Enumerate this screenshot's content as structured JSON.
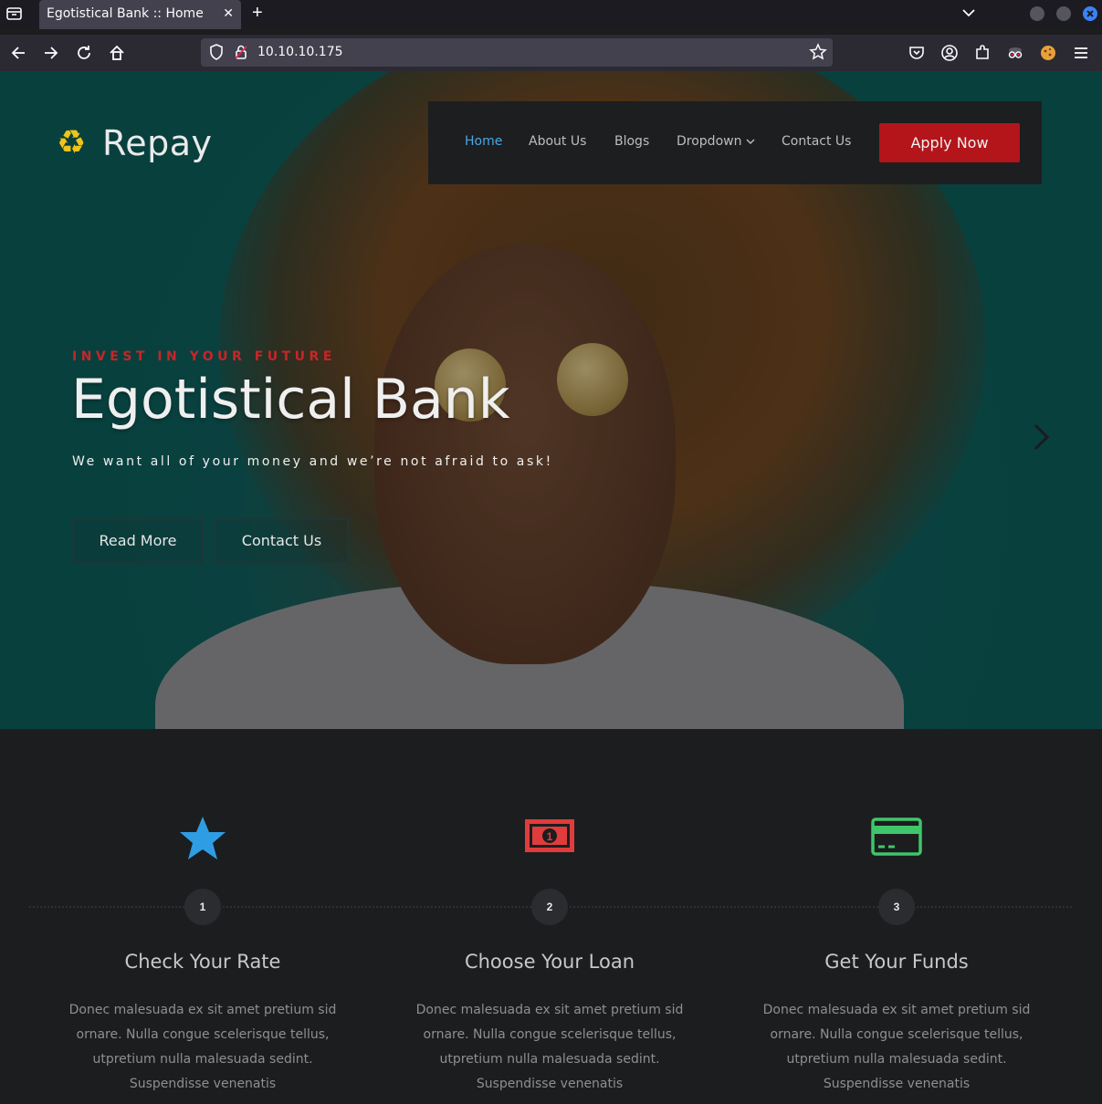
{
  "browser": {
    "tab_title": "Egotistical Bank :: Home",
    "tab_close": "✕",
    "new_tab": "+",
    "url": "10.10.10.175"
  },
  "site": {
    "logo_text": "Repay",
    "nav": {
      "home": "Home",
      "about": "About Us",
      "blogs": "Blogs",
      "dropdown": "Dropdown",
      "contact": "Contact Us",
      "apply": "Apply Now"
    },
    "hero": {
      "kicker": "INVEST IN YOUR FUTURE",
      "title": "Egotistical Bank",
      "subtitle": "We want all of your money and we’re not afraid to ask!",
      "read_more": "Read More",
      "contact": "Contact Us"
    },
    "steps": [
      {
        "num": "1",
        "title": "Check Your Rate",
        "icon": "star-icon",
        "color": "#2f9de4",
        "text": "Donec malesuada ex sit amet pretium sid ornare. Nulla congue scelerisque tellus, utpretium nulla malesuada sedint. Suspendisse venenatis"
      },
      {
        "num": "2",
        "title": "Choose Your Loan",
        "icon": "money-bill-icon",
        "color": "#e03c3c",
        "text": "Donec malesuada ex sit amet pretium sid ornare. Nulla congue scelerisque tellus, utpretium nulla malesuada sedint. Suspendisse venenatis"
      },
      {
        "num": "3",
        "title": "Get Your Funds",
        "icon": "credit-card-icon",
        "color": "#3fc66a",
        "text": "Donec malesuada ex sit amet pretium sid ornare. Nulla congue scelerisque tellus, utpretium nulla malesuada sedint. Suspendisse venenatis"
      }
    ]
  }
}
